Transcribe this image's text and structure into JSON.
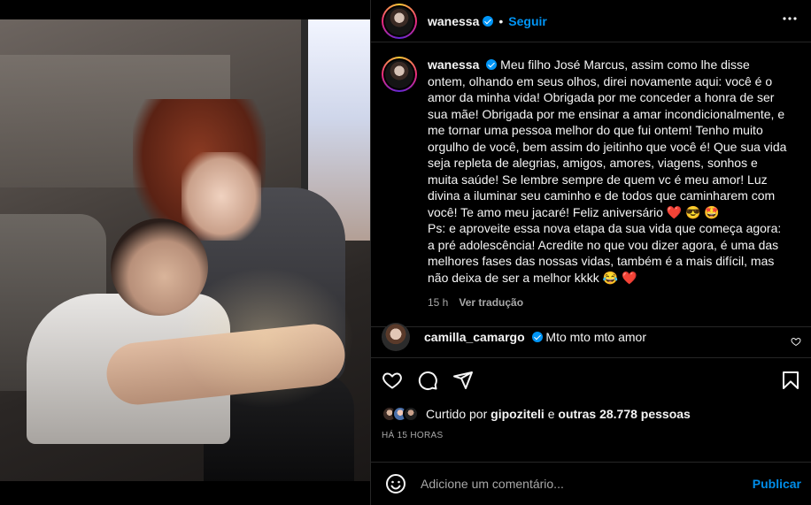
{
  "post": {
    "author": "wanessa",
    "follow_label": "Seguir",
    "dot": "•",
    "more_label": "•••"
  },
  "caption": {
    "author": "wanessa",
    "text": "Meu filho José Marcus, assim como lhe disse ontem, olhando em seus olhos, direi novamente aqui: você é o amor da minha vida! Obrigada por me conceder a honra de ser sua mãe! Obrigada por me ensinar a amar incondicionalmente, e me tornar uma pessoa melhor do que fui ontem! Tenho muito orgulho de você, bem assim do jeitinho que você é! Que sua vida seja repleta de alegrias, amigos, amores, viagens, sonhos e muita saúde! Se lembre sempre de quem vc é meu amor! Luz divina a iluminar seu caminho e de todos que caminharem com você! Te amo meu jacaré! Feliz aniversário",
    "emojis_1": "❤️ 😎 🤩",
    "ps": "Ps: e aproveite essa nova etapa da sua vida que começa agora: a pré adolescência! Acredite no que vou dizer agora, é uma das melhores fases das nossas vidas, também é a mais difícil, mas não deixa de ser a melhor kkkk",
    "emojis_2": "😂 ❤️",
    "age": "15 h",
    "translate_label": "Ver tradução"
  },
  "comment": {
    "author": "camilla_camargo",
    "text": "Mto mto mto amor"
  },
  "likes": {
    "prefix": "Curtido por",
    "user": "gipoziteli",
    "middle": "e",
    "others": "outras 28.778 pessoas"
  },
  "timestamp": "HÁ 15 HORAS",
  "composer": {
    "placeholder": "Adicione um comentário...",
    "post_label": "Publicar"
  },
  "icons": [
    "heart-icon",
    "comment-icon",
    "share-icon",
    "bookmark-icon",
    "emoji-icon",
    "more-icon",
    "verified-icon"
  ],
  "colors": {
    "accent": "#0095f6",
    "background": "#000000",
    "text": "#f5f5f5",
    "muted": "#a8a8a8",
    "divider": "#262626",
    "like": "#ed4956"
  }
}
